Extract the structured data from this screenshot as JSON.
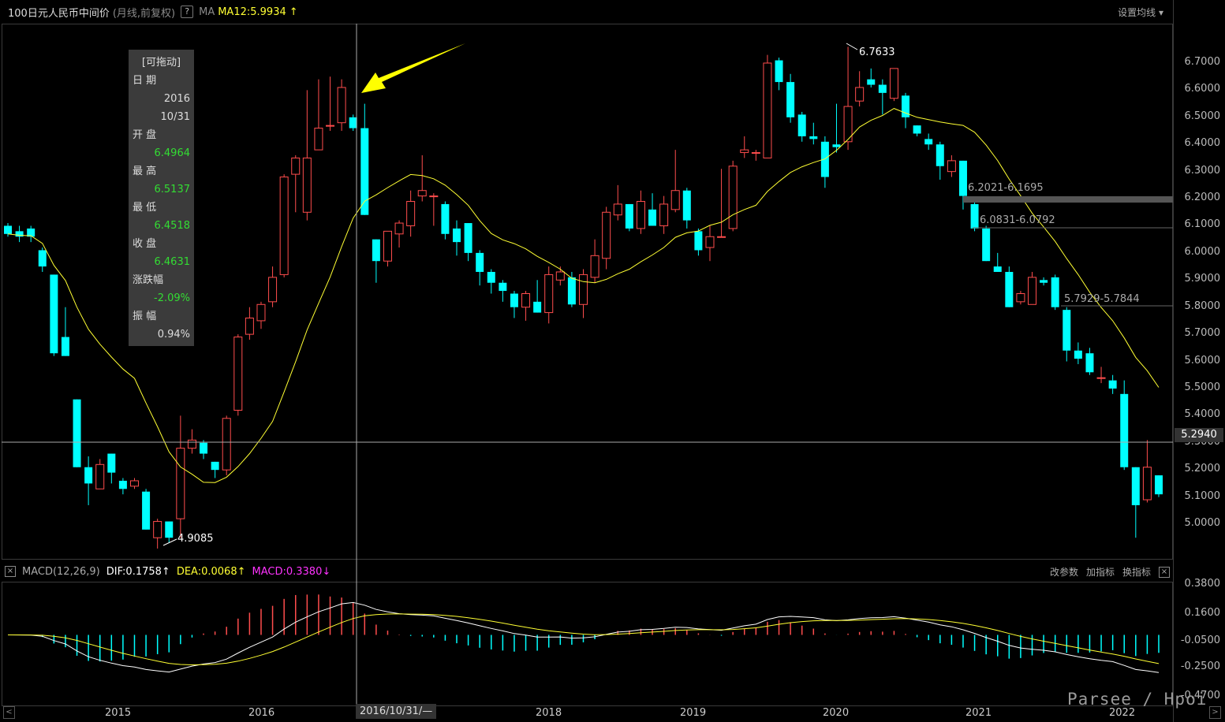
{
  "header": {
    "title": "100日元人民币中间价",
    "mode": "(月线,前复权)",
    "help": "?",
    "ma_label": "MA",
    "ma_value": "MA12:5.9934",
    "ma_arrow": "↑",
    "settings": "设置均线",
    "settings_arrow": "▾"
  },
  "tooltip": {
    "title": "[可拖动]",
    "date_label": "日  期",
    "year": "2016",
    "day": "10/31",
    "open_label": "开  盘",
    "open": "6.4964",
    "high_label": "最  高",
    "high": "6.5137",
    "low_label": "最  低",
    "low": "6.4518",
    "close_label": "收  盘",
    "close": "6.4631",
    "change_label": "涨跌幅",
    "change": "-2.09%",
    "amp_label": "振  幅",
    "amp": "0.94%"
  },
  "annotations": {
    "high_marker": "6.7633",
    "low_marker": "4.9085",
    "zone1": "6.2021-6.1695",
    "zone2": "6.0831-6.0792",
    "zone3": "5.7929-5.7844",
    "crosshair_date": "2016/10/31/—",
    "crosshair_price": "5.2940"
  },
  "macd_header": {
    "name": "MACD(12,26,9)",
    "dif": "DIF:0.1758",
    "dif_arrow": "↑",
    "dea": "DEA:0.0068",
    "dea_arrow": "↑",
    "macd": "MACD:0.3380",
    "macd_arrow": "↓",
    "btn_params": "改参数",
    "btn_add": "加指标",
    "btn_switch": "换指标",
    "close": "×"
  },
  "price_axis": [
    "6.7000",
    "6.6000",
    "6.5000",
    "6.4000",
    "6.3000",
    "6.2000",
    "6.1000",
    "6.0000",
    "5.9000",
    "5.8000",
    "5.7000",
    "5.6000",
    "5.5000",
    "5.4000",
    "5.3000",
    "5.2000",
    "5.1000",
    "5.0000"
  ],
  "macd_axis": [
    "0.3800",
    "0.1600",
    "-0.0500",
    "-0.2500",
    "-0.4700"
  ],
  "x_axis": [
    "2015",
    "2016",
    "2018",
    "2019",
    "2020",
    "2021",
    "2022"
  ],
  "nav": {
    "left": "<",
    "right": ">"
  },
  "watermark": "Parsee / Hpoi",
  "colors": {
    "up": "#ff4d4d",
    "down": "#00ffff",
    "ma": "#ffff33",
    "dif": "#ffffff",
    "dea": "#ffff33",
    "macd": "#ff33ff"
  },
  "chart_data": {
    "type": "candlestick",
    "period": "monthly",
    "y_range": [
      4.9,
      6.8
    ],
    "candles": [
      [
        6.1,
        6.07,
        6.11,
        6.06
      ],
      [
        6.08,
        6.06,
        6.1,
        6.04
      ],
      [
        6.09,
        6.06,
        6.1,
        6.04
      ],
      [
        6.01,
        5.95,
        6.02,
        5.93
      ],
      [
        5.92,
        5.63,
        5.92,
        5.62
      ],
      [
        5.69,
        5.62,
        5.8,
        5.62
      ],
      [
        5.46,
        5.21,
        5.46,
        5.21
      ],
      [
        5.21,
        5.15,
        5.25,
        5.07
      ],
      [
        5.13,
        5.22,
        5.24,
        5.13
      ],
      [
        5.26,
        5.19,
        5.26,
        5.15
      ],
      [
        5.16,
        5.13,
        5.17,
        5.11
      ],
      [
        5.14,
        5.16,
        5.17,
        5.13
      ],
      [
        5.12,
        4.98,
        5.13,
        4.98
      ],
      [
        4.95,
        5.01,
        5.02,
        4.91
      ],
      [
        5.01,
        4.95,
        5.01,
        4.93
      ],
      [
        5.02,
        5.28,
        5.4,
        4.95
      ],
      [
        5.28,
        5.31,
        5.35,
        5.26
      ],
      [
        5.3,
        5.26,
        5.31,
        5.24
      ],
      [
        5.23,
        5.2,
        5.23,
        5.17
      ],
      [
        5.2,
        5.39,
        5.4,
        5.18
      ],
      [
        5.42,
        5.69,
        5.7,
        5.4
      ],
      [
        5.7,
        5.76,
        5.8,
        5.68
      ],
      [
        5.75,
        5.81,
        5.82,
        5.72
      ],
      [
        5.82,
        5.91,
        5.95,
        5.8
      ],
      [
        5.92,
        6.28,
        6.29,
        5.91
      ],
      [
        6.29,
        6.35,
        6.36,
        6.15
      ],
      [
        6.15,
        6.35,
        6.6,
        6.12
      ],
      [
        6.38,
        6.46,
        6.64,
        6.42
      ],
      [
        6.47,
        6.47,
        6.65,
        6.45
      ],
      [
        6.48,
        6.61,
        6.64,
        6.45
      ],
      [
        6.5,
        6.46,
        6.51,
        6.45
      ],
      [
        6.46,
        6.14,
        6.55,
        6.14
      ],
      [
        6.05,
        5.97,
        6.05,
        5.89
      ],
      [
        5.97,
        6.08,
        6.08,
        5.95
      ],
      [
        6.07,
        6.11,
        6.12,
        6.02
      ],
      [
        6.1,
        6.19,
        6.23,
        6.06
      ],
      [
        6.21,
        6.23,
        6.36,
        6.19
      ],
      [
        6.21,
        6.21,
        6.22,
        6.1
      ],
      [
        6.18,
        6.07,
        6.19,
        6.05
      ],
      [
        6.09,
        6.04,
        6.12,
        5.99
      ],
      [
        6.11,
        6.0,
        6.11,
        5.97
      ],
      [
        6.0,
        5.93,
        6.01,
        5.88
      ],
      [
        5.93,
        5.89,
        5.94,
        5.85
      ],
      [
        5.89,
        5.86,
        5.9,
        5.82
      ],
      [
        5.85,
        5.8,
        5.86,
        5.76
      ],
      [
        5.8,
        5.85,
        5.86,
        5.75
      ],
      [
        5.82,
        5.78,
        5.9,
        5.78
      ],
      [
        5.78,
        5.92,
        5.95,
        5.74
      ],
      [
        5.9,
        5.93,
        5.95,
        5.88
      ],
      [
        5.91,
        5.81,
        5.93,
        5.8
      ],
      [
        5.81,
        5.92,
        5.94,
        5.76
      ],
      [
        5.91,
        5.99,
        6.05,
        5.89
      ],
      [
        5.98,
        6.15,
        6.17,
        5.94
      ],
      [
        6.14,
        6.18,
        6.25,
        6.12
      ],
      [
        6.18,
        6.09,
        6.18,
        6.08
      ],
      [
        6.09,
        6.19,
        6.23,
        6.07
      ],
      [
        6.16,
        6.1,
        6.22,
        6.1
      ],
      [
        6.1,
        6.18,
        6.21,
        6.07
      ],
      [
        6.16,
        6.23,
        6.38,
        6.15
      ],
      [
        6.23,
        6.12,
        6.24,
        6.09
      ],
      [
        6.08,
        6.01,
        6.09,
        5.99
      ],
      [
        6.02,
        6.06,
        6.1,
        5.97
      ],
      [
        6.06,
        6.06,
        6.31,
        6.06
      ],
      [
        6.09,
        6.32,
        6.34,
        6.08
      ],
      [
        6.37,
        6.38,
        6.43,
        6.35
      ],
      [
        6.37,
        6.37,
        6.38,
        6.34
      ],
      [
        6.35,
        6.7,
        6.73,
        6.35
      ],
      [
        6.71,
        6.63,
        6.72,
        6.6
      ],
      [
        6.63,
        6.5,
        6.66,
        6.48
      ],
      [
        6.51,
        6.43,
        6.52,
        6.41
      ],
      [
        6.43,
        6.42,
        6.48,
        6.4
      ],
      [
        6.41,
        6.28,
        6.43,
        6.24
      ],
      [
        6.4,
        6.39,
        6.55,
        6.37
      ],
      [
        6.41,
        6.54,
        6.76,
        6.38
      ],
      [
        6.56,
        6.61,
        6.67,
        6.54
      ],
      [
        6.64,
        6.62,
        6.68,
        6.61
      ],
      [
        6.62,
        6.59,
        6.64,
        6.51
      ],
      [
        6.57,
        6.68,
        6.68,
        6.56
      ],
      [
        6.58,
        6.5,
        6.59,
        6.46
      ],
      [
        6.47,
        6.44,
        6.47,
        6.43
      ],
      [
        6.42,
        6.4,
        6.44,
        6.38
      ],
      [
        6.4,
        6.32,
        6.41,
        6.27
      ],
      [
        6.3,
        6.34,
        6.36,
        6.28
      ],
      [
        6.34,
        6.21,
        6.34,
        6.16
      ],
      [
        6.18,
        6.09,
        6.19,
        6.08
      ],
      [
        6.09,
        5.97,
        6.1,
        5.97
      ],
      [
        5.95,
        5.93,
        6.0,
        5.93
      ],
      [
        5.93,
        5.8,
        5.95,
        5.8
      ],
      [
        5.82,
        5.85,
        5.86,
        5.81
      ],
      [
        5.81,
        5.91,
        5.93,
        5.81
      ],
      [
        5.9,
        5.89,
        5.91,
        5.88
      ],
      [
        5.91,
        5.8,
        5.92,
        5.79
      ],
      [
        5.79,
        5.64,
        5.8,
        5.6
      ],
      [
        5.64,
        5.61,
        5.67,
        5.59
      ],
      [
        5.63,
        5.56,
        5.65,
        5.55
      ],
      [
        5.54,
        5.54,
        5.58,
        5.52
      ],
      [
        5.53,
        5.5,
        5.55,
        5.48
      ],
      [
        5.48,
        5.21,
        5.53,
        5.2
      ],
      [
        5.21,
        5.07,
        5.21,
        4.95
      ],
      [
        5.09,
        5.21,
        5.31,
        5.08
      ],
      [
        5.18,
        5.11,
        5.18,
        5.1
      ]
    ]
  }
}
